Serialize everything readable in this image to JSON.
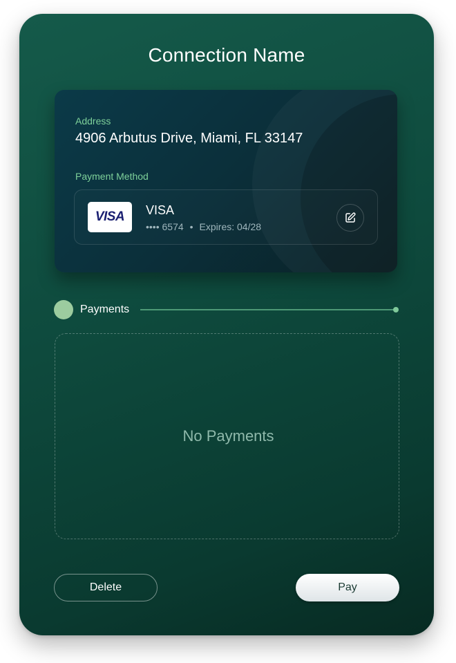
{
  "window": {
    "title": "Connection Name"
  },
  "address": {
    "label": "Address",
    "value": "4906 Arbutus Drive, Miami, FL 33147"
  },
  "payment_method": {
    "label": "Payment Method",
    "brand_logo_text": "VISA",
    "brand": "VISA",
    "masked_number": "•••• 6574",
    "separator": "•",
    "expires": "Expires: 04/28",
    "edit_icon": "edit-icon"
  },
  "payments": {
    "title": "Payments",
    "empty_text": "No Payments"
  },
  "actions": {
    "delete_label": "Delete",
    "pay_label": "Pay"
  },
  "colors": {
    "card_background": "#0e4a3d",
    "accent_green": "#7ed19a",
    "section_dot": "#9ccc9f",
    "visa_blue": "#1a1f71"
  }
}
